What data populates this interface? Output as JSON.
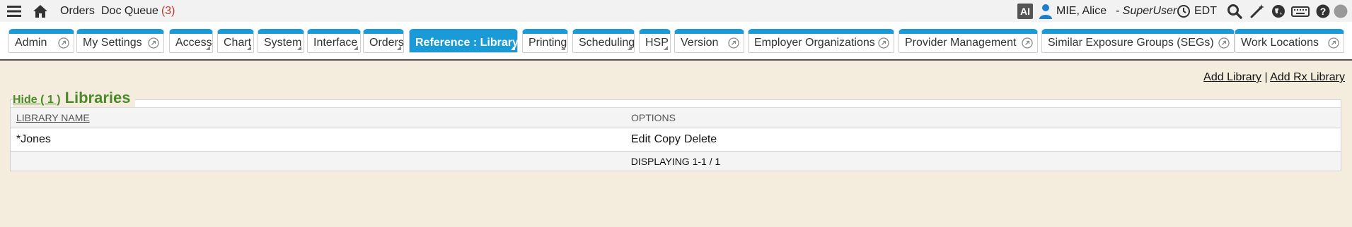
{
  "topbar": {
    "orders": "Orders",
    "doc_queue": "Doc Queue",
    "doc_queue_count": "(3)",
    "ai": "AI",
    "user": "MIE, Alice",
    "role": "- SuperUser",
    "timezone": "EDT"
  },
  "tabs": [
    {
      "label": "Admin",
      "active": false
    },
    {
      "label": "My Settings",
      "active": false
    },
    {
      "label": "Access",
      "active": false
    },
    {
      "label": "Chart",
      "active": false
    },
    {
      "label": "System",
      "active": false
    },
    {
      "label": "Interface",
      "active": false
    },
    {
      "label": "Orders",
      "active": false
    },
    {
      "label": "Reference : Library",
      "active": true
    },
    {
      "label": "Printing",
      "active": false
    },
    {
      "label": "Scheduling",
      "active": false
    },
    {
      "label": "HSP",
      "active": false
    },
    {
      "label": "Version",
      "active": false
    },
    {
      "label": "Employer Organizations",
      "active": false
    },
    {
      "label": "Provider Management",
      "active": false
    },
    {
      "label": "Similar Exposure Groups (SEGs)",
      "active": false
    },
    {
      "label": "Work Locations",
      "active": false
    }
  ],
  "content": {
    "add_library": "Add Library",
    "separator": "|",
    "add_rx_library": "Add Rx Library",
    "hide_link": "Hide ( 1 )",
    "title": "Libraries",
    "columns": [
      "LIBRARY NAME",
      "OPTIONS"
    ],
    "rows": [
      {
        "name": "*Jones",
        "options": [
          "Edit",
          "Copy",
          "Delete"
        ]
      }
    ],
    "footer": "DISPLAYING 1-1 / 1"
  }
}
